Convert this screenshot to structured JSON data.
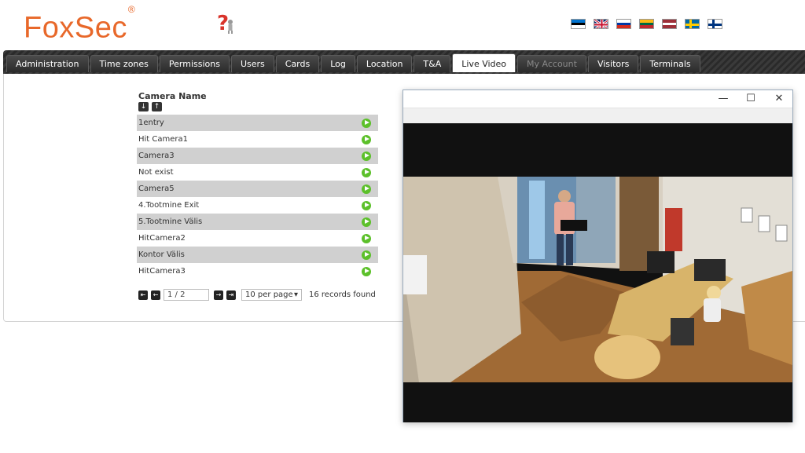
{
  "header": {
    "logo_text": "FoxSec",
    "logo_mark": "®",
    "help_icon": "help-question-icon",
    "languages": [
      "Estonian",
      "English",
      "Russian",
      "Lithuanian",
      "Latvian",
      "Swedish",
      "Finnish"
    ]
  },
  "nav": {
    "tabs": [
      {
        "label": "Administration"
      },
      {
        "label": "Time zones"
      },
      {
        "label": "Permissions"
      },
      {
        "label": "Users"
      },
      {
        "label": "Cards"
      },
      {
        "label": "Log"
      },
      {
        "label": "Location"
      },
      {
        "label": "T&A"
      },
      {
        "label": "Live Video"
      },
      {
        "label": "My Account"
      },
      {
        "label": "Visitors"
      },
      {
        "label": "Terminals"
      }
    ],
    "active": "Live Video"
  },
  "cameras": {
    "column_header": "Camera Name",
    "sort_desc": "↓",
    "sort_asc": "↑",
    "items": [
      {
        "name": "1entry"
      },
      {
        "name": "Hit Camera1"
      },
      {
        "name": "Camera3"
      },
      {
        "name": "Not exist"
      },
      {
        "name": "Camera5"
      },
      {
        "name": "4.Tootmine Exit"
      },
      {
        "name": "5.Tootmine Välis"
      },
      {
        "name": "HitCamera2"
      },
      {
        "name": "Kontor Välis"
      },
      {
        "name": "HitCamera3"
      }
    ]
  },
  "pager": {
    "first": "⇤",
    "prev": "←",
    "page": "1 / 2",
    "next": "→",
    "last": "⇥",
    "per_page": "10 per page",
    "records": "16 records found"
  },
  "video_window": {
    "minimize": "—",
    "maximize": "☐",
    "close": "✕"
  },
  "colors": {
    "brand": "#e8682a",
    "row_alt": "#d0d0d0",
    "play": "#5cc02a"
  }
}
